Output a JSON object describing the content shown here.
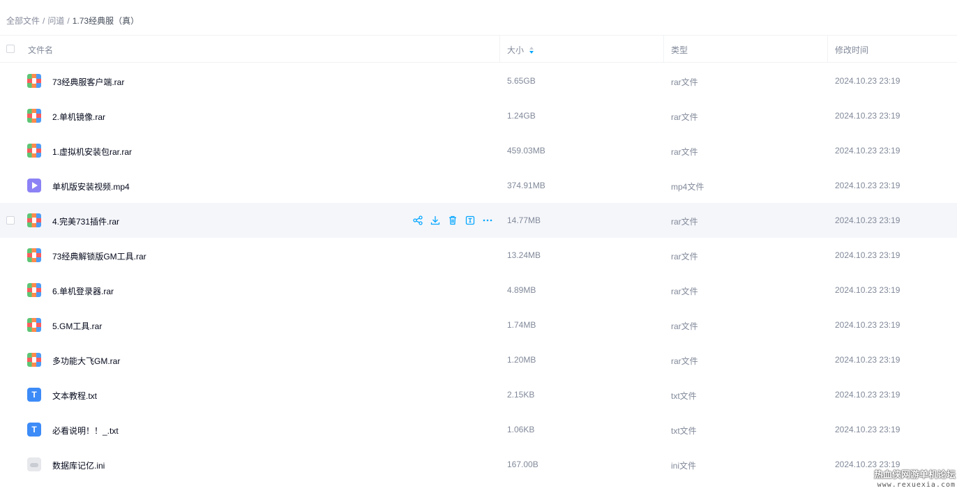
{
  "breadcrumb": {
    "root": "全部文件",
    "parent": "问道",
    "current": "1.73经典服（真）",
    "separator": "/"
  },
  "columns": {
    "name": "文件名",
    "size": "大小",
    "type": "类型",
    "modified": "修改时间"
  },
  "sort": {
    "column": "size",
    "order": "descending"
  },
  "colors": {
    "accent": "#06a7ff",
    "text": "#03081a",
    "muted": "#818999",
    "hover_row": "#f5f6fa"
  },
  "files": [
    {
      "icon": "rar-archive-icon",
      "name": "73经典服客户端.rar",
      "size": "5.65GB",
      "type": "rar文件",
      "modified": "2024.10.23 23:19"
    },
    {
      "icon": "rar-archive-icon",
      "name": "2.单机镜像.rar",
      "size": "1.24GB",
      "type": "rar文件",
      "modified": "2024.10.23 23:19"
    },
    {
      "icon": "rar-archive-icon",
      "name": "1.虚拟机安装包rar.rar",
      "size": "459.03MB",
      "type": "rar文件",
      "modified": "2024.10.23 23:19"
    },
    {
      "icon": "video-file-icon",
      "name": "单机版安装视频.mp4",
      "size": "374.91MB",
      "type": "mp4文件",
      "modified": "2024.10.23 23:19"
    },
    {
      "icon": "rar-archive-icon",
      "name": "4.完美731插件.rar",
      "size": "14.77MB",
      "type": "rar文件",
      "modified": "2024.10.23 23:19",
      "hovered": true
    },
    {
      "icon": "rar-archive-icon",
      "name": "73经典解锁版GM工具.rar",
      "size": "13.24MB",
      "type": "rar文件",
      "modified": "2024.10.23 23:19"
    },
    {
      "icon": "rar-archive-icon",
      "name": "6.单机登录器.rar",
      "size": "4.89MB",
      "type": "rar文件",
      "modified": "2024.10.23 23:19"
    },
    {
      "icon": "rar-archive-icon",
      "name": "5.GM工具.rar",
      "size": "1.74MB",
      "type": "rar文件",
      "modified": "2024.10.23 23:19"
    },
    {
      "icon": "rar-archive-icon",
      "name": "多功能大飞GM.rar",
      "size": "1.20MB",
      "type": "rar文件",
      "modified": "2024.10.23 23:19"
    },
    {
      "icon": "text-file-icon",
      "name": "文本教程.txt",
      "size": "2.15KB",
      "type": "txt文件",
      "modified": "2024.10.23 23:19"
    },
    {
      "icon": "text-file-icon",
      "name": "必看说明！！_.txt",
      "size": "1.06KB",
      "type": "txt文件",
      "modified": "2024.10.23 23:19"
    },
    {
      "icon": "config-file-icon",
      "name": "数据库记亿.ini",
      "size": "167.00B",
      "type": "ini文件",
      "modified": "2024.10.23 23:19"
    }
  ],
  "row_actions": [
    "share-icon",
    "download-icon",
    "delete-icon",
    "info-icon",
    "more-icon"
  ],
  "txt_icon_glyph": "T",
  "watermark": {
    "title": "热血侠网游单机论坛",
    "url": "www.rexuexia.com"
  }
}
